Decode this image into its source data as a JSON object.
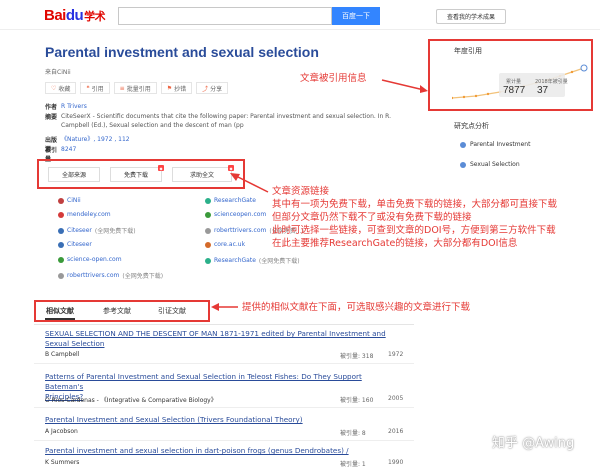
{
  "header": {
    "logo": {
      "b1": "Bai",
      "b2": "du",
      "b3": "学术"
    },
    "search_button": "百度一下",
    "my_achievements": "查看我的学术成果"
  },
  "paper": {
    "title": "Parental investment and sexual selection",
    "source": "来自CiNii",
    "actions": [
      {
        "label": "收藏",
        "icon": "heart-icon"
      },
      {
        "label": "引用",
        "icon": "quote-icon"
      },
      {
        "label": "批量引用",
        "icon": "list-icon"
      },
      {
        "label": "抄错",
        "icon": "flag-icon"
      },
      {
        "label": "分享",
        "icon": "share-icon"
      }
    ],
    "author_key": "作者",
    "author_val": "R Trivers",
    "abstract_key": "摘要",
    "abstract_line1": "CiteSeerX - Scientific documents that cite the following paper: Parental investment and sexual selection. In R.",
    "abstract_line2": "Campbell (Ed.), Sexual selection and the descent of man (pp",
    "pub_key": "出版源",
    "pub_val": "《Nature》, 1972 , 112",
    "cited_key": "被引量",
    "cited_val": "8247"
  },
  "download": {
    "all_sources": "全部来源",
    "free_download": "免费下载",
    "request_full": "求助全文"
  },
  "sources_left": [
    {
      "name": "CiNii",
      "note": "",
      "color": "#c04040"
    },
    {
      "name": "mendeley.com",
      "note": "",
      "color": "#d43a3a"
    },
    {
      "name": "Citeseer",
      "note": "(全网免费下载)",
      "color": "#3a6fb5"
    },
    {
      "name": "Citeseer",
      "note": "",
      "color": "#3a6fb5"
    },
    {
      "name": "science-open.com",
      "note": "",
      "color": "#3a9a3a"
    },
    {
      "name": "roberttrivers.com",
      "note": "(全网免费下载)",
      "color": "#999999"
    }
  ],
  "sources_right": [
    {
      "name": "ResearchGate",
      "note": "",
      "color": "#2bb08a"
    },
    {
      "name": "scienceopen.com",
      "note": "",
      "color": "#3a9a3a"
    },
    {
      "name": "roberttrivers.com",
      "note": "(全网免费...)",
      "color": "#999999"
    },
    {
      "name": "core.ac.uk",
      "note": "",
      "color": "#d46a2a"
    },
    {
      "name": "ResearchGate",
      "note": "(全网免费下载)",
      "color": "#2bb08a"
    }
  ],
  "annotations": {
    "cite_info": "文章被引用信息",
    "src_line1": "文章资源链接",
    "src_line2": "其中有一项为免费下载，单击免费下载的链接，大部分都可直接下载",
    "src_line3": "但部分文章仍然下载不了或没有免费下载的链接",
    "src_line4": "此时可选择一些链接，可查到文章的DOI号，方便到第三方软件下载",
    "src_line5": "在此主要推荐ResearchGate的链接，大部分都有DOI信息",
    "related": "提供的相似文献在下面，可选取感兴趣的文章进行下载"
  },
  "citation_panel": {
    "title": "年度引用",
    "total_label": "累计量",
    "total_value": "7877",
    "year_label": "2018年被引量",
    "year_value": "37"
  },
  "study": {
    "title": "研究点分析",
    "items": [
      "Parental Investment",
      "Sexual Selection"
    ]
  },
  "tabs": [
    "相似文献",
    "参考文献",
    "引证文献"
  ],
  "references": [
    {
      "title1": "SEXUAL SELECTION AND THE DESCENT OF MAN 1871-1971 edited by Parental Investment and",
      "title2": "Sexual Selection",
      "author": "B Campbell",
      "cites": "被引量: 318",
      "year": "1972"
    },
    {
      "title1": "Patterns of Parental Investment and Sexual Selection in Teleost Fishes: Do They Support Bateman's",
      "title2": "Principles?",
      "author": "O Rios-Cardenas - 《Integrative & Comparative Biology》",
      "cites": "被引量: 160",
      "year": "2005"
    },
    {
      "title1": "Parental Investment and Sexual Selection (Trivers Foundational Theory)",
      "title2": "",
      "author": "A Jacobson",
      "cites": "被引量: 8",
      "year": "2016"
    },
    {
      "title1": "Parental investment and sexual selection in dart-poison frogs (genus Dendrobates) /",
      "title2": "",
      "author": "K Summers",
      "cites": "被引量: 1",
      "year": "1990"
    }
  ],
  "watermark": "知乎 @Awing"
}
